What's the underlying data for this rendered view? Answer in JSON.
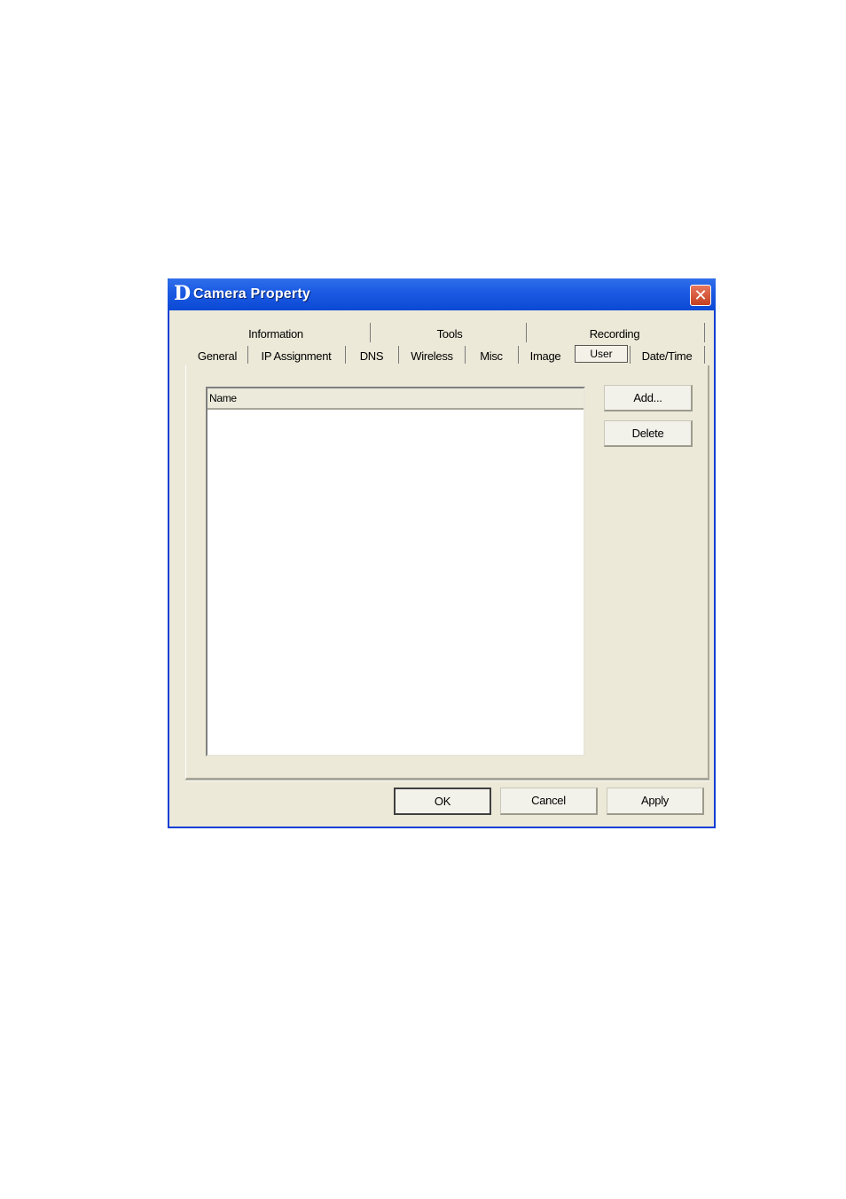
{
  "window": {
    "title": "Camera Property",
    "app_icon_glyph": "D",
    "close_glyph": "✕"
  },
  "tabs": {
    "row_top": [
      "Information",
      "Tools",
      "Recording"
    ],
    "row_bottom": [
      "General",
      "IP Assignment",
      "DNS",
      "Wireless",
      "Misc",
      "Image",
      "User",
      "Date/Time"
    ],
    "active": "User"
  },
  "user_panel": {
    "list_header": "Name",
    "add_button": "Add...",
    "delete_button": "Delete"
  },
  "footer": {
    "ok_button": "OK",
    "cancel_button": "Cancel",
    "apply_button": "Apply"
  },
  "colors": {
    "titlebar": "#0b49d5",
    "window_bg": "#ece9d8",
    "close_button": "#c5401f"
  }
}
